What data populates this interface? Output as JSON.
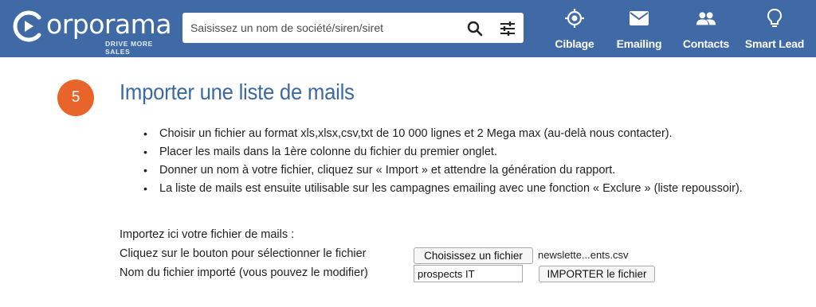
{
  "header": {
    "logo_text": "orporama",
    "logo_tagline": "DRIVE MORE SALES",
    "search": {
      "placeholder": "Saisissez un nom de société/siren/siret",
      "value": ""
    },
    "nav": [
      {
        "label": "Ciblage",
        "icon": "target-icon"
      },
      {
        "label": "Emailing",
        "icon": "envelope-icon"
      },
      {
        "label": "Contacts",
        "icon": "people-icon"
      },
      {
        "label": "Smart Lead",
        "icon": "lightbulb-icon"
      }
    ]
  },
  "colors": {
    "header_bg": "#3f6aa5",
    "accent_orange": "#e8642a",
    "title_blue": "#3b6aa3"
  },
  "step": {
    "number": "5"
  },
  "main": {
    "title": "Importer une liste de mails",
    "bullets": [
      "Choisir un fichier au format xls,xlsx,csv,txt de 10 000 lignes et 2 Mega max (au-delà nous contacter).",
      "Placer les mails dans la 1ère colonne du fichier du premier onglet.",
      "Donner un nom à votre fichier, cliquez sur « Import » et attendre la génération du rapport.",
      "La liste de mails est ensuite utilisable sur les campagnes emailing avec une fonction « Exclure » (liste repoussoir)."
    ],
    "form": {
      "intro": "Importez ici votre fichier de mails :",
      "choose_label": "Cliquez sur le bouton pour sélectionner le fichier",
      "choose_button": "Choisissez un fichier",
      "selected_file": "newslette...ents.csv",
      "name_label": "Nom du fichier importé (vous pouvez le modifier)",
      "name_value": "prospects IT",
      "import_button": "IMPORTER le fichier"
    }
  }
}
